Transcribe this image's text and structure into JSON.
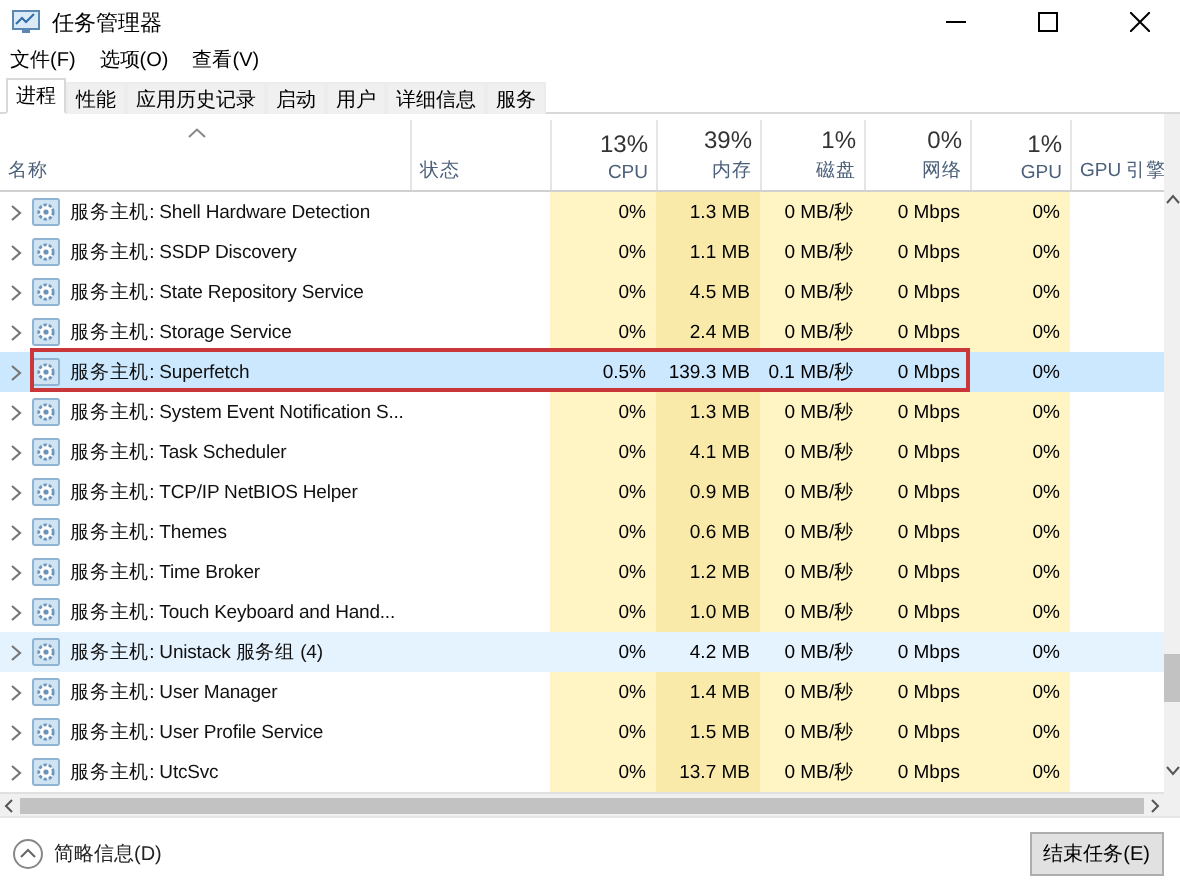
{
  "window": {
    "title": "任务管理器"
  },
  "menu": [
    "文件(F)",
    "选项(O)",
    "查看(V)"
  ],
  "tabs": [
    {
      "label": "进程",
      "selected": true
    },
    {
      "label": "性能",
      "selected": false
    },
    {
      "label": "应用历史记录",
      "selected": false
    },
    {
      "label": "启动",
      "selected": false
    },
    {
      "label": "用户",
      "selected": false
    },
    {
      "label": "详细信息",
      "selected": false
    },
    {
      "label": "服务",
      "selected": false
    }
  ],
  "columns": [
    {
      "kind": "name",
      "label": "名称",
      "sorted": true
    },
    {
      "kind": "text",
      "label": "状态"
    },
    {
      "kind": "metric",
      "total": "13%",
      "label": "CPU"
    },
    {
      "kind": "metric",
      "total": "39%",
      "label": "内存"
    },
    {
      "kind": "metric",
      "total": "1%",
      "label": "磁盘"
    },
    {
      "kind": "metric",
      "total": "0%",
      "label": "网络"
    },
    {
      "kind": "metric",
      "total": "1%",
      "label": "GPU"
    },
    {
      "kind": "text",
      "label": "GPU 引擎"
    }
  ],
  "rows": [
    {
      "name": "服务主机: Shell Hardware Detection",
      "cpu": "0%",
      "memory": "1.3 MB",
      "disk": "0 MB/秒",
      "network": "0 Mbps",
      "gpu": "0%",
      "selected": false,
      "hovered": false,
      "annotated": false
    },
    {
      "name": "服务主机: SSDP Discovery",
      "cpu": "0%",
      "memory": "1.1 MB",
      "disk": "0 MB/秒",
      "network": "0 Mbps",
      "gpu": "0%",
      "selected": false,
      "hovered": false,
      "annotated": false
    },
    {
      "name": "服务主机: State Repository Service",
      "cpu": "0%",
      "memory": "4.5 MB",
      "disk": "0 MB/秒",
      "network": "0 Mbps",
      "gpu": "0%",
      "selected": false,
      "hovered": false,
      "annotated": false
    },
    {
      "name": "服务主机: Storage Service",
      "cpu": "0%",
      "memory": "2.4 MB",
      "disk": "0 MB/秒",
      "network": "0 Mbps",
      "gpu": "0%",
      "selected": false,
      "hovered": false,
      "annotated": false
    },
    {
      "name": "服务主机: Superfetch",
      "cpu": "0.5%",
      "memory": "139.3 MB",
      "disk": "0.1 MB/秒",
      "network": "0 Mbps",
      "gpu": "0%",
      "selected": true,
      "hovered": false,
      "annotated": true
    },
    {
      "name": "服务主机: System Event Notification S...",
      "cpu": "0%",
      "memory": "1.3 MB",
      "disk": "0 MB/秒",
      "network": "0 Mbps",
      "gpu": "0%",
      "selected": false,
      "hovered": false,
      "annotated": false
    },
    {
      "name": "服务主机: Task Scheduler",
      "cpu": "0%",
      "memory": "4.1 MB",
      "disk": "0 MB/秒",
      "network": "0 Mbps",
      "gpu": "0%",
      "selected": false,
      "hovered": false,
      "annotated": false
    },
    {
      "name": "服务主机: TCP/IP NetBIOS Helper",
      "cpu": "0%",
      "memory": "0.9 MB",
      "disk": "0 MB/秒",
      "network": "0 Mbps",
      "gpu": "0%",
      "selected": false,
      "hovered": false,
      "annotated": false
    },
    {
      "name": "服务主机: Themes",
      "cpu": "0%",
      "memory": "0.6 MB",
      "disk": "0 MB/秒",
      "network": "0 Mbps",
      "gpu": "0%",
      "selected": false,
      "hovered": false,
      "annotated": false
    },
    {
      "name": "服务主机: Time Broker",
      "cpu": "0%",
      "memory": "1.2 MB",
      "disk": "0 MB/秒",
      "network": "0 Mbps",
      "gpu": "0%",
      "selected": false,
      "hovered": false,
      "annotated": false
    },
    {
      "name": "服务主机: Touch Keyboard and Hand...",
      "cpu": "0%",
      "memory": "1.0 MB",
      "disk": "0 MB/秒",
      "network": "0 Mbps",
      "gpu": "0%",
      "selected": false,
      "hovered": false,
      "annotated": false
    },
    {
      "name": "服务主机: Unistack 服务组 (4)",
      "cpu": "0%",
      "memory": "4.2 MB",
      "disk": "0 MB/秒",
      "network": "0 Mbps",
      "gpu": "0%",
      "selected": false,
      "hovered": true,
      "annotated": false
    },
    {
      "name": "服务主机: User Manager",
      "cpu": "0%",
      "memory": "1.4 MB",
      "disk": "0 MB/秒",
      "network": "0 Mbps",
      "gpu": "0%",
      "selected": false,
      "hovered": false,
      "annotated": false
    },
    {
      "name": "服务主机: User Profile Service",
      "cpu": "0%",
      "memory": "1.5 MB",
      "disk": "0 MB/秒",
      "network": "0 Mbps",
      "gpu": "0%",
      "selected": false,
      "hovered": false,
      "annotated": false
    },
    {
      "name": "服务主机: UtcSvc",
      "cpu": "0%",
      "memory": "13.7 MB",
      "disk": "0 MB/秒",
      "network": "0 Mbps",
      "gpu": "0%",
      "selected": false,
      "hovered": false,
      "annotated": false
    }
  ],
  "footer": {
    "details_link": "简略信息(D)",
    "end_task_button": "结束任务(E)"
  }
}
